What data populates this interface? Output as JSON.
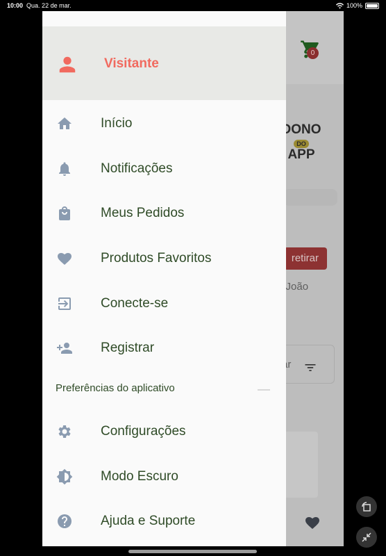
{
  "status_bar": {
    "time": "10:00",
    "date": "Qua. 22 de mar.",
    "battery": "100%"
  },
  "background_app": {
    "cart_count": "0",
    "logo_line1": "DONO",
    "logo_do": "DO",
    "logo_line2": "APP",
    "pickup_button": "retirar",
    "location_text": "o João",
    "filter_text": "rar"
  },
  "drawer": {
    "user_name": "Visitante",
    "items": [
      {
        "label": "Início",
        "icon": "home-icon"
      },
      {
        "label": "Notificações",
        "icon": "bell-icon"
      },
      {
        "label": "Meus Pedidos",
        "icon": "shopping-bag-icon"
      },
      {
        "label": "Produtos Favoritos",
        "icon": "heart-icon"
      },
      {
        "label": "Conecte-se",
        "icon": "login-icon"
      },
      {
        "label": "Registrar",
        "icon": "person-add-icon"
      }
    ],
    "section_title": "Preferências do aplicativo",
    "section_items": [
      {
        "label": "Configurações",
        "icon": "gear-icon"
      },
      {
        "label": "Modo Escuro",
        "icon": "brightness-icon"
      },
      {
        "label": "Ajuda e Suporte",
        "icon": "help-icon"
      }
    ]
  },
  "colors": {
    "accent": "#f16a5f",
    "menu_text": "#2f4b27",
    "icon": "#8a9bb0",
    "header_bg": "#e8e9e6"
  }
}
